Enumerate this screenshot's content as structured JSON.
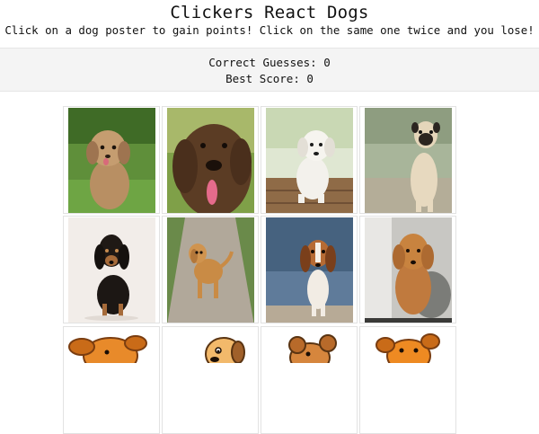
{
  "header": {
    "title": "Clickers React Dogs",
    "subtitle": "Click on a dog poster to gain points! Click on the same one twice and you lose!"
  },
  "scoreboard": {
    "correct_label": "Correct Guesses: ",
    "correct_value": "0",
    "best_label": "Best Score: ",
    "best_value": "0"
  },
  "cards": [
    {
      "dog": "havanese-puppy-on-grass"
    },
    {
      "dog": "brown-doodle-on-grass"
    },
    {
      "dog": "white-labrador-puppy-on-deck"
    },
    {
      "dog": "pug-on-grass"
    },
    {
      "dog": "black-and-tan-dachshund"
    },
    {
      "dog": "golden-puppy-on-path"
    },
    {
      "dog": "beagle-on-beach"
    },
    {
      "dog": "poodle-on-couch"
    },
    {
      "dog": "cartoon-dog"
    },
    {
      "dog": "cartoon-dog"
    },
    {
      "dog": "cartoon-dog"
    },
    {
      "dog": "cartoon-dog"
    }
  ]
}
